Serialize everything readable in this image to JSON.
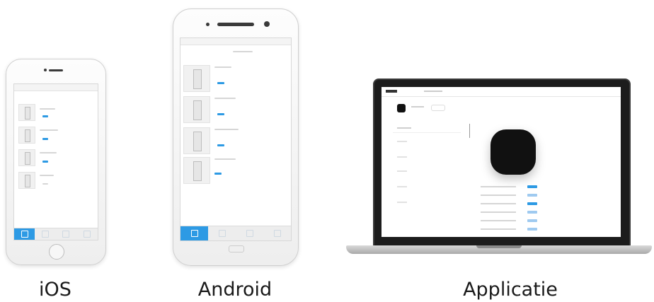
{
  "captions": {
    "ios": "iOS",
    "android": "Android",
    "desktop": "Applicatie"
  },
  "colors": {
    "accent": "#2d9ae4",
    "background": "#ffffff",
    "laptop_bezel": "#1c1c1c",
    "hub": "#111111"
  }
}
